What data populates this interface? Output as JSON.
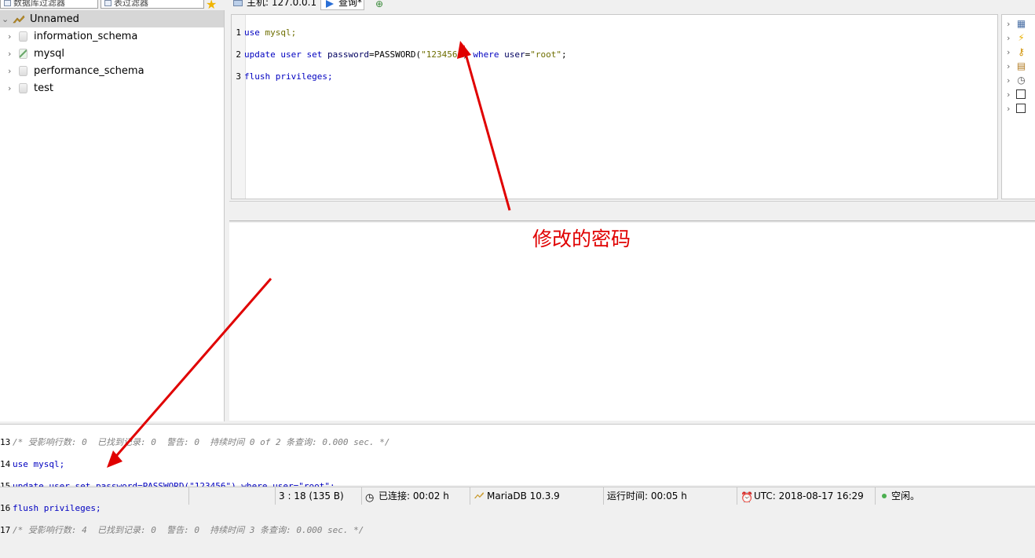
{
  "filters": {
    "db_filter": "数据库过滤器",
    "table_filter": "表过滤器"
  },
  "tabs": {
    "host": "主机: 127.0.0.1",
    "query": "查询*"
  },
  "tree": {
    "root": "Unnamed",
    "items": [
      {
        "label": "information_schema"
      },
      {
        "label": "mysql"
      },
      {
        "label": "performance_schema"
      },
      {
        "label": "test"
      }
    ]
  },
  "editor": {
    "lines": [
      {
        "n": "1",
        "a": "use",
        "b": " mysql;",
        "c": "",
        "d": "",
        "e": "",
        "f": ""
      },
      {
        "n": "2"
      },
      {
        "n": "3",
        "a": "flush privileges;"
      }
    ],
    "line2": {
      "k1": "update user set ",
      "col": "password",
      "eq": "=PASSWORD(",
      "val": "\"123456\"",
      "close": ") ",
      "where": "where ",
      "user": "user",
      "eq2": "=",
      "root": "\"root\"",
      "end": ";"
    }
  },
  "annotation": "修改的密码",
  "log": {
    "lines": [
      {
        "n": "13",
        "text": "/* 受影响行数: 0  已找到记录: 0  警告: 0  持续时间 0 of 2 条查询: 0.000 sec. */"
      },
      {
        "n": "14",
        "text": "use mysql;"
      },
      {
        "n": "15",
        "text": "update user set password=PASSWORD(\"123456\") where user=\"root\";"
      },
      {
        "n": "16",
        "text": "flush privileges;"
      },
      {
        "n": "17",
        "text": "/* 受影响行数: 4  已找到记录: 0  警告: 0  持续时间 3 条查询: 0.000 sec. */"
      }
    ]
  },
  "status": {
    "position": "3 : 18 (135 B)",
    "connected": "已连接: 00:02 h",
    "server": "MariaDB 10.3.9",
    "uptime": "运行时间: 00:05 h",
    "utc": "UTC: 2018-08-17 16:29",
    "state": "空闲。"
  },
  "colors": {
    "keyword": "#0000c0",
    "string": "#6e6e00",
    "annotation": "#e00000"
  }
}
